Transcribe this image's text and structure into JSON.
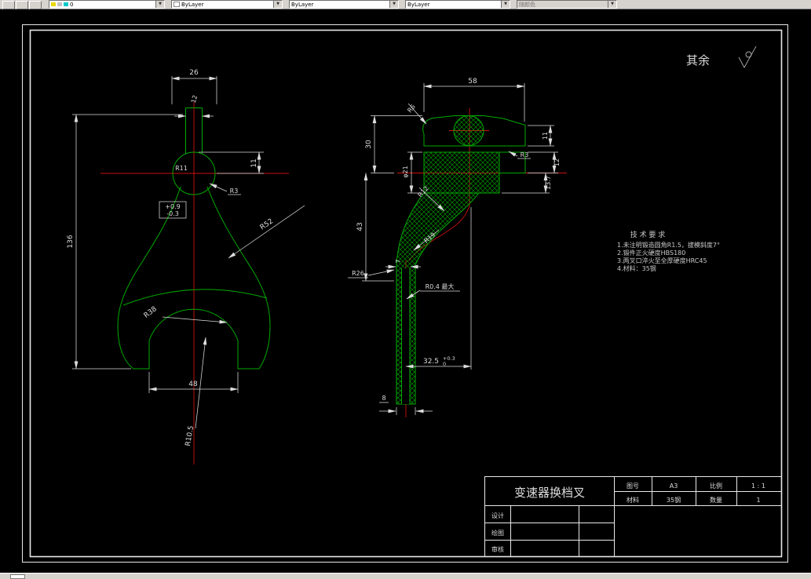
{
  "toolbar": {
    "layer_value": "0",
    "color_value": "ByLayer",
    "linetype_value": "ByLayer",
    "lineweight_value": "ByLayer",
    "plotstyle_value": "随颜色"
  },
  "annotations": {
    "surplus": "其余"
  },
  "tech": {
    "title": "技 术 要 求",
    "l1": "1.未注明锻造圆角R1.5，拔模斜度7°",
    "l2": "2.锻件正火硬度HBS180",
    "l3": "3.两叉口淬火至全厚硬度HRC45",
    "l4": "4.材料：35钢"
  },
  "front": {
    "d26": "26",
    "d12": "12",
    "d11": "11",
    "r11": "R11",
    "r3": "R3",
    "tol_top": "+0.9",
    "tol_bot": "-0.3",
    "d136": "136",
    "r52": "R52",
    "r38": "R38",
    "d48": "48",
    "r105": "R10.5"
  },
  "side": {
    "d58": "58",
    "r6": "R6",
    "d11": "11",
    "r3": "R3",
    "d12": "12",
    "d137": "13.7",
    "d30": "30",
    "d43": "43",
    "phi21": "φ21",
    "r12": "R12",
    "r19": "R19",
    "d7": "7",
    "r26": "R26",
    "r04": "R0.4 最大",
    "d325": "32.5",
    "d325_up": "+0.3",
    "d325_dn": "0",
    "d8": "8"
  },
  "title_block": {
    "part_name": "变速器换档叉",
    "drawing_no_label": "图号",
    "drawing_no": "A3",
    "scale_label": "比例",
    "scale": "1 : 1",
    "material_label": "材料",
    "material": "35钢",
    "qty_label": "数量",
    "qty": "1",
    "design_label": "设计",
    "draw_label": "绘图",
    "check_label": "审核"
  },
  "colors": {
    "line": "#00aa00",
    "centerline": "#cc1111",
    "dimension": "#dcdcdc",
    "frame": "#e8e8e8"
  }
}
